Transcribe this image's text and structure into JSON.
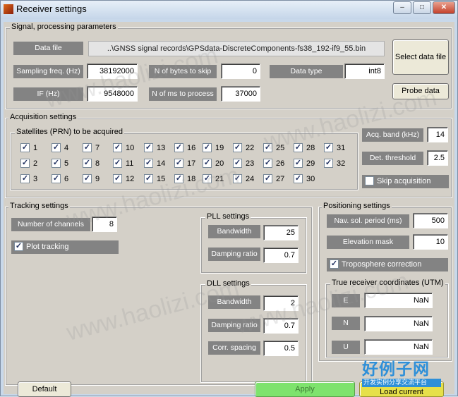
{
  "window": {
    "title": "Receiver settings",
    "min": "–",
    "max": "□",
    "close": "✕"
  },
  "signal": {
    "title": "Signal, processing parameters",
    "data_file_label": "Data file",
    "data_file_path": "..\\GNSS signal records\\GPSdata-DiscreteComponents-fs38_192-if9_55.bin",
    "select_button": "Select data file",
    "probe_button": "Probe data",
    "sampling_label": "Sampling freq. (Hz)",
    "sampling_value": "38192000",
    "bytes_skip_label": "N of bytes to skip",
    "bytes_skip_value": "0",
    "data_type_label": "Data type",
    "data_type_value": "int8",
    "if_label": "IF (Hz)",
    "if_value": "9548000",
    "ms_label": "N of ms to process",
    "ms_value": "37000"
  },
  "acquisition": {
    "title": "Acquisition settings",
    "sats_title": "Satellites (PRN) to be acquired",
    "sats": [
      "1",
      "4",
      "7",
      "10",
      "13",
      "16",
      "19",
      "22",
      "25",
      "28",
      "31",
      "2",
      "5",
      "8",
      "11",
      "14",
      "17",
      "20",
      "23",
      "26",
      "29",
      "32",
      "3",
      "6",
      "9",
      "12",
      "15",
      "18",
      "21",
      "24",
      "27",
      "30"
    ],
    "band_label": "Acq. band (kHz)",
    "band_value": "14",
    "threshold_label": "Det. threshold",
    "threshold_value": "2.5",
    "skip_label": "Skip acquisition"
  },
  "tracking": {
    "title": "Tracking settings",
    "channels_label": "Number of channels",
    "channels_value": "8",
    "plot_label": "Plot tracking",
    "pll_title": "PLL settings",
    "pll_bw_label": "Bandwidth",
    "pll_bw_value": "25",
    "pll_damp_label": "Damping ratio",
    "pll_damp_value": "0.7",
    "dll_title": "DLL settings",
    "dll_bw_label": "Bandwidth",
    "dll_bw_value": "2",
    "dll_damp_label": "Damping ratio",
    "dll_damp_value": "0.7",
    "dll_corr_label": "Corr. spacing",
    "dll_corr_value": "0.5"
  },
  "positioning": {
    "title": "Positioning settings",
    "period_label": "Nav. sol. period (ms)",
    "period_value": "500",
    "mask_label": "Elevation mask",
    "mask_value": "10",
    "tropo_label": "Troposphere correction",
    "coords_title": "True receiver coordinates (UTM)",
    "e_label": "E",
    "e_value": "NaN",
    "n_label": "N",
    "n_value": "NaN",
    "u_label": "U",
    "u_value": "NaN"
  },
  "footer": {
    "default_button": "Default",
    "apply_button": "Apply",
    "load_button": "Load current"
  },
  "watermark": "www.haolizi.com",
  "logo": {
    "text": "好例子网",
    "sub": "开发实例分享交流平台"
  },
  "check_mark": "✓"
}
